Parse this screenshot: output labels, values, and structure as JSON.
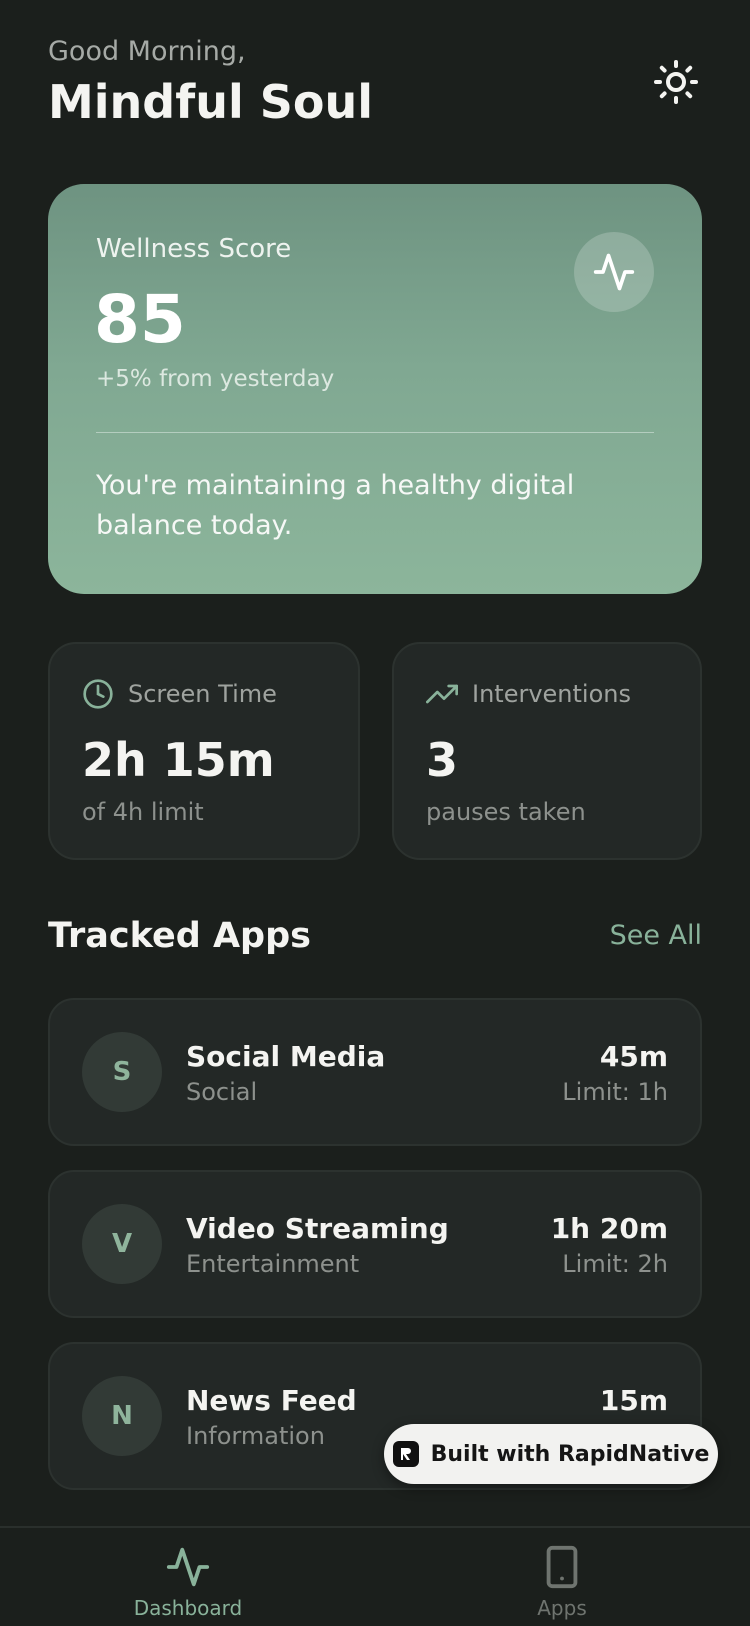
{
  "header": {
    "greeting": "Good Morning,",
    "username": "Mindful Soul",
    "theme_icon": "sun-icon"
  },
  "wellness": {
    "label": "Wellness Score",
    "score": "85",
    "change": "+5% from yesterday",
    "message": "You're maintaining a healthy digital balance today.",
    "icon": "activity-icon"
  },
  "stats": {
    "screen_time": {
      "label": "Screen Time",
      "value": "2h 15m",
      "sub": "of 4h limit",
      "icon": "clock-icon"
    },
    "interventions": {
      "label": "Interventions",
      "value": "3",
      "sub": "pauses taken",
      "icon": "trending-up-icon"
    }
  },
  "tracked": {
    "title": "Tracked Apps",
    "see_all": "See All",
    "apps": [
      {
        "initial": "S",
        "name": "Social Media",
        "category": "Social",
        "time": "45m",
        "limit": "Limit: 1h"
      },
      {
        "initial": "V",
        "name": "Video Streaming",
        "category": "Entertainment",
        "time": "1h 20m",
        "limit": "Limit: 2h"
      },
      {
        "initial": "N",
        "name": "News Feed",
        "category": "Information",
        "time": "15m",
        "limit": ""
      }
    ]
  },
  "badge": {
    "label": "Built with RapidNative"
  },
  "tabs": [
    {
      "label": "Dashboard",
      "icon": "activity-icon",
      "active": true
    },
    {
      "label": "Apps",
      "icon": "smartphone-icon",
      "active": false
    }
  ],
  "colors": {
    "background": "#1b1f1c",
    "card": "#232826",
    "accent": "#89b29a",
    "wellness_gradient_top": "#6e9381",
    "wellness_gradient_bottom": "#8cb59b"
  }
}
